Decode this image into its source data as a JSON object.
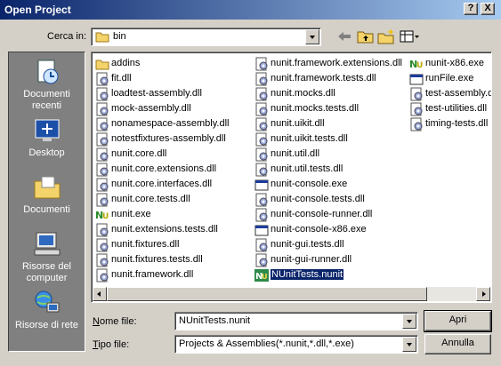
{
  "window": {
    "title": "Open Project",
    "help_label": "?",
    "close_label": "X"
  },
  "lookin": {
    "label": "Cerca in:",
    "value": "bin"
  },
  "toolbar": {
    "tools": [
      "back-icon",
      "up-folder-icon",
      "new-folder-icon",
      "view-menu-icon"
    ]
  },
  "places": [
    {
      "label": "Documenti recenti",
      "icon": "recent-documents-icon"
    },
    {
      "label": "Desktop",
      "icon": "desktop-icon"
    },
    {
      "label": "Documenti",
      "icon": "documents-folder-icon"
    },
    {
      "label": "Risorse del computer",
      "icon": "my-computer-icon"
    },
    {
      "label": "Risorse di rete",
      "icon": "network-places-icon"
    }
  ],
  "files": {
    "col1": [
      {
        "name": "addins",
        "type": "folder"
      },
      {
        "name": "fit.dll",
        "type": "dll"
      },
      {
        "name": "loadtest-assembly.dll",
        "type": "dll"
      },
      {
        "name": "mock-assembly.dll",
        "type": "dll"
      },
      {
        "name": "nonamespace-assembly.dll",
        "type": "dll"
      },
      {
        "name": "notestfixtures-assembly.dll",
        "type": "dll"
      },
      {
        "name": "nunit.core.dll",
        "type": "dll"
      },
      {
        "name": "nunit.core.extensions.dll",
        "type": "dll"
      },
      {
        "name": "nunit.core.interfaces.dll",
        "type": "dll"
      },
      {
        "name": "nunit.core.tests.dll",
        "type": "dll"
      },
      {
        "name": "nunit.exe",
        "type": "nunit"
      },
      {
        "name": "nunit.extensions.tests.dll",
        "type": "dll"
      },
      {
        "name": "nunit.fixtures.dll",
        "type": "dll"
      },
      {
        "name": "nunit.fixtures.tests.dll",
        "type": "dll"
      },
      {
        "name": "nunit.framework.dll",
        "type": "dll"
      }
    ],
    "col2": [
      {
        "name": "nunit.framework.extensions.dll",
        "type": "dll"
      },
      {
        "name": "nunit.framework.tests.dll",
        "type": "dll"
      },
      {
        "name": "nunit.mocks.dll",
        "type": "dll"
      },
      {
        "name": "nunit.mocks.tests.dll",
        "type": "dll"
      },
      {
        "name": "nunit.uikit.dll",
        "type": "dll"
      },
      {
        "name": "nunit.uikit.tests.dll",
        "type": "dll"
      },
      {
        "name": "nunit.util.dll",
        "type": "dll"
      },
      {
        "name": "nunit.util.tests.dll",
        "type": "dll"
      },
      {
        "name": "nunit-console.exe",
        "type": "exe"
      },
      {
        "name": "nunit-console.tests.dll",
        "type": "dll"
      },
      {
        "name": "nunit-console-runner.dll",
        "type": "dll"
      },
      {
        "name": "nunit-console-x86.exe",
        "type": "exe"
      },
      {
        "name": "nunit-gui.tests.dll",
        "type": "dll"
      },
      {
        "name": "nunit-gui-runner.dll",
        "type": "dll"
      },
      {
        "name": "NUnitTests.nunit",
        "type": "nunitproj",
        "selected": true
      }
    ],
    "col3": [
      {
        "name": "nunit-x86.exe",
        "type": "nunit"
      },
      {
        "name": "runFile.exe",
        "type": "exe"
      },
      {
        "name": "test-assembly.dll",
        "type": "dll"
      },
      {
        "name": "test-utilities.dll",
        "type": "dll"
      },
      {
        "name": "timing-tests.dll",
        "type": "dll"
      }
    ]
  },
  "filename": {
    "label_prefix": "N",
    "label_rest": "ome file:",
    "value": "NUnitTests.nunit"
  },
  "filetype": {
    "label_prefix": "T",
    "label_rest": "ipo file:",
    "value": "Projects & Assemblies(*.nunit,*.dll,*.exe)"
  },
  "buttons": {
    "open": "Apri",
    "cancel": "Annulla"
  }
}
